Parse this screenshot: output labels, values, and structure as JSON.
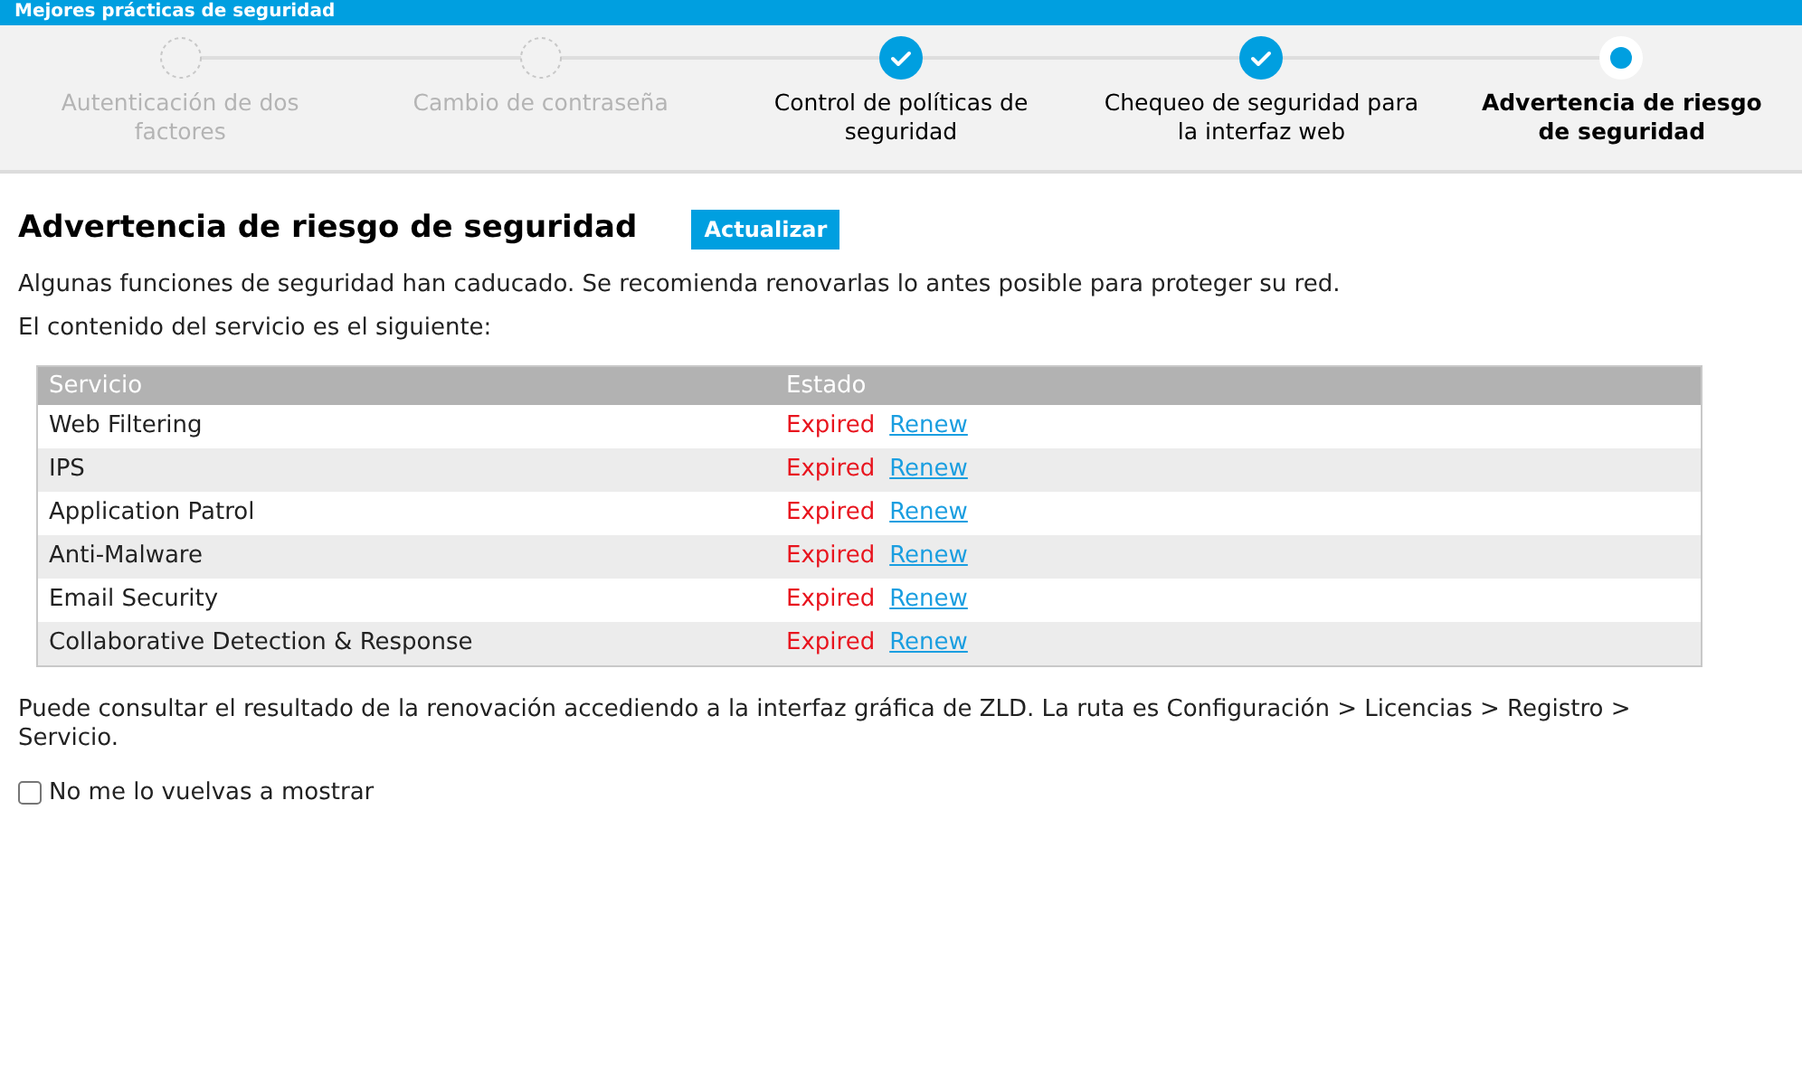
{
  "window": {
    "title": "Mejores prácticas de seguridad"
  },
  "steps": [
    {
      "label": "Autenticación de dos factores",
      "kind": "pending"
    },
    {
      "label": "Cambio de contraseña",
      "kind": "pending"
    },
    {
      "label": "Control de políticas de seguridad",
      "kind": "done"
    },
    {
      "label": "Chequeo de seguridad para la interfaz web",
      "kind": "done"
    },
    {
      "label": "Advertencia de riesgo de seguridad",
      "kind": "current"
    }
  ],
  "heading": "Advertencia de riesgo de seguridad",
  "refresh_button": "Actualizar",
  "intro": "Algunas funciones de seguridad han caducado. Se recomienda renovarlas lo antes posible para proteger su red.",
  "subheading": "El contenido del servicio es el siguiente:",
  "table": {
    "columns": [
      "Servicio",
      "Estado"
    ],
    "rows": [
      {
        "service": "Web Filtering",
        "status": "Expired",
        "action": "Renew"
      },
      {
        "service": "IPS",
        "status": "Expired",
        "action": "Renew"
      },
      {
        "service": "Application Patrol",
        "status": "Expired",
        "action": "Renew"
      },
      {
        "service": "Anti-Malware",
        "status": "Expired",
        "action": "Renew"
      },
      {
        "service": "Email Security",
        "status": "Expired",
        "action": "Renew"
      },
      {
        "service": "Collaborative Detection & Response",
        "status": "Expired",
        "action": "Renew"
      }
    ]
  },
  "note": "Puede consultar el resultado de la renovación accediendo a la interfaz gráfica de ZLD. La ruta es Configuración > Licencias > Registro > Servicio.",
  "dont_show_again": {
    "label": "No me lo vuelvas a mostrar",
    "checked": false
  }
}
